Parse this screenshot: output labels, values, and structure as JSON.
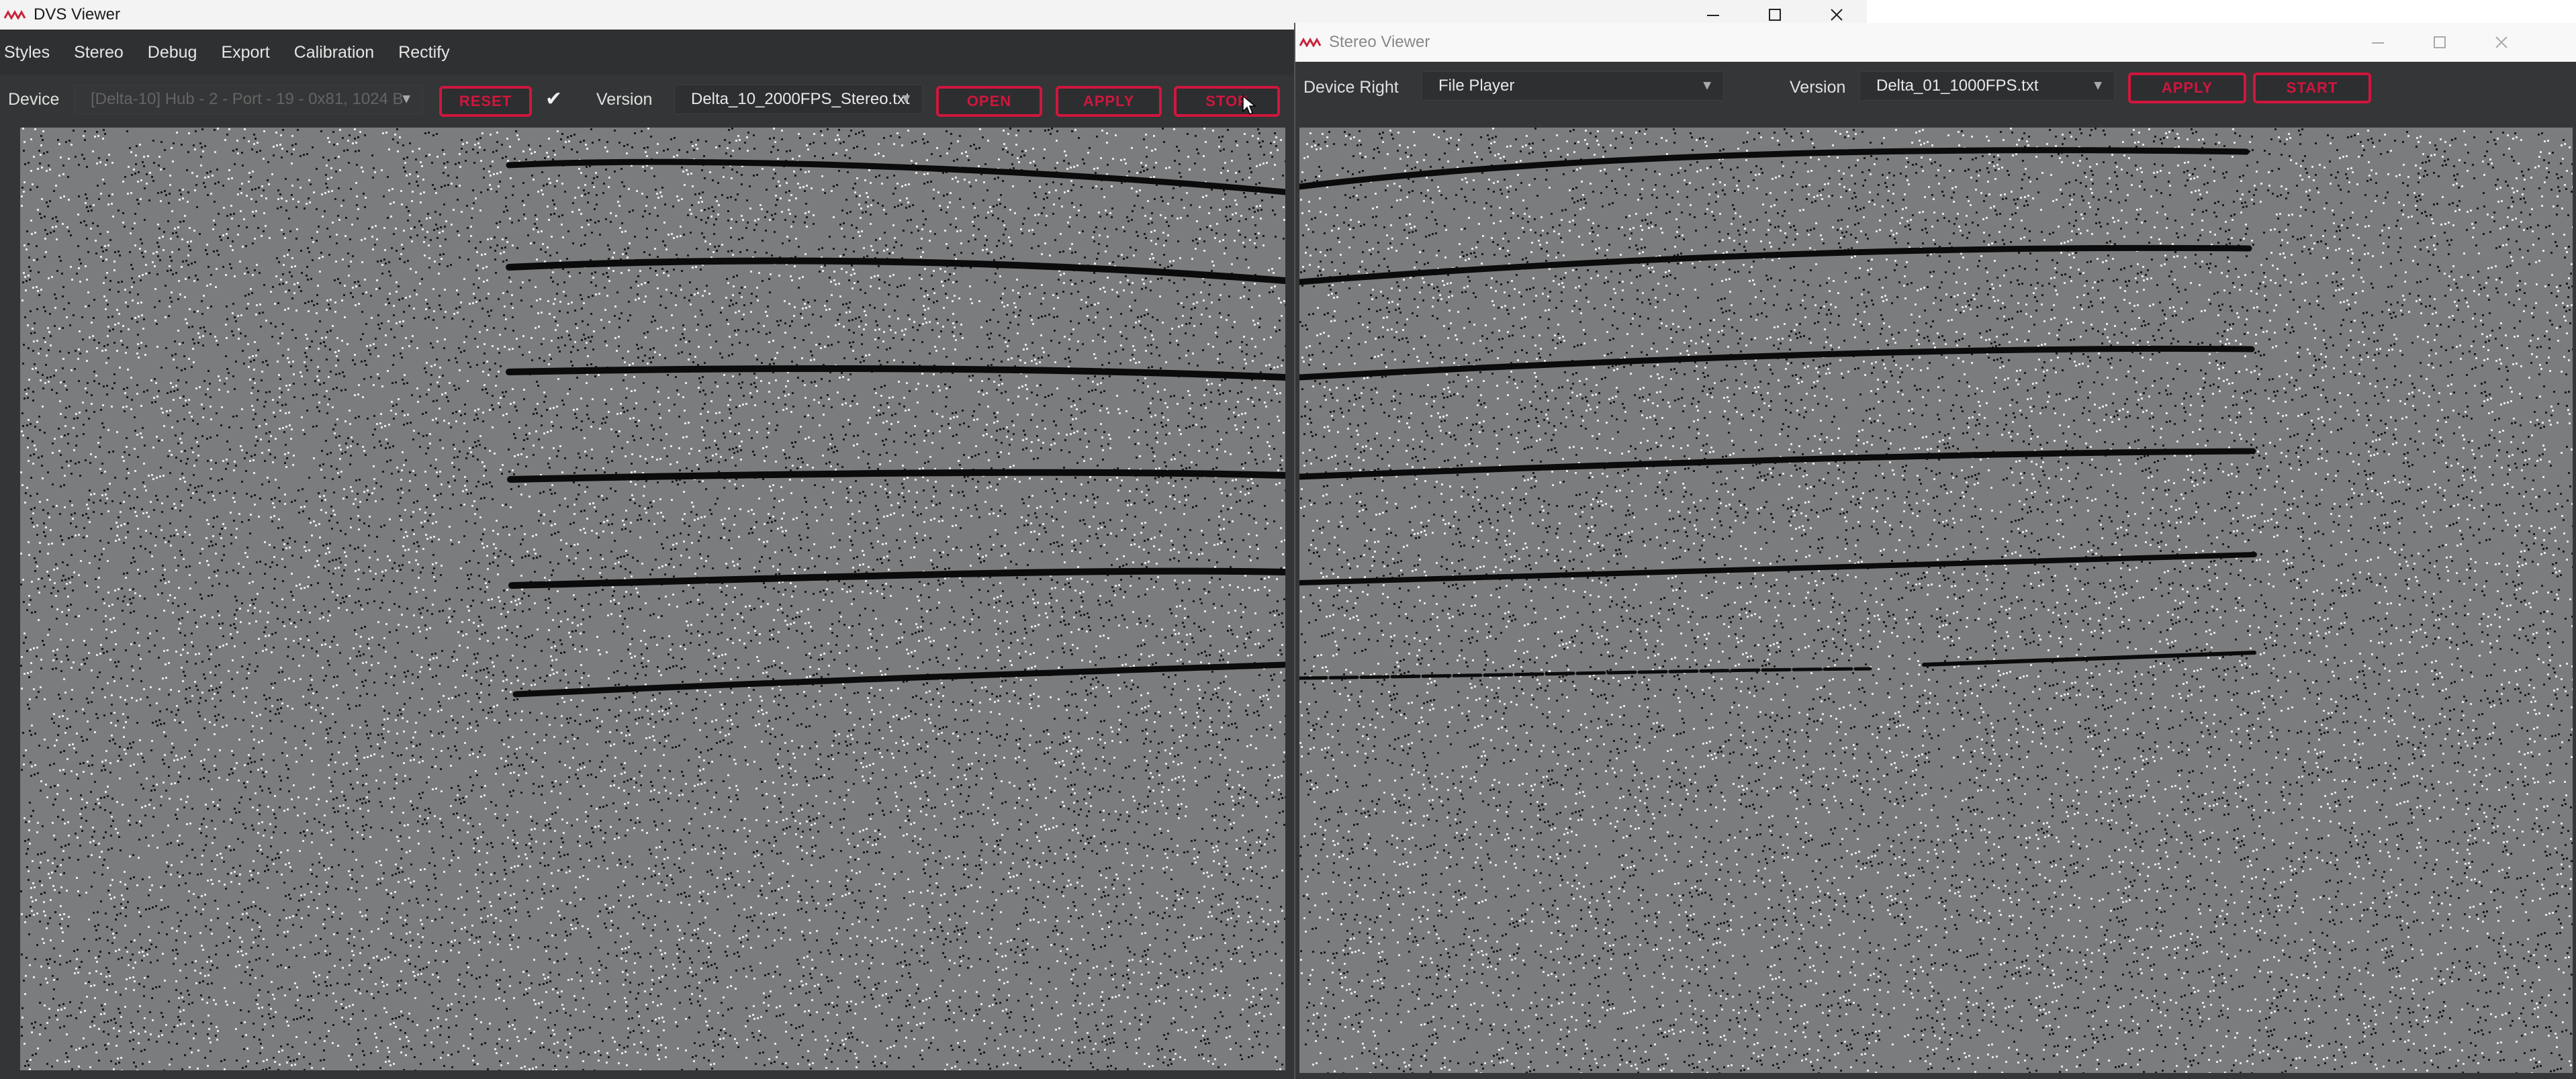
{
  "left_window": {
    "title": "DVS Viewer",
    "menu": [
      "Styles",
      "Stereo",
      "Debug",
      "Export",
      "Calibration",
      "Rectify"
    ],
    "toolbar": {
      "device_label": "Device",
      "device_value": "[Delta-10] Hub - 2 - Port - 19 - 0x81, 1024 B",
      "reset_label": "RESET",
      "check_glyph": "✔",
      "version_label": "Version",
      "version_value": "Delta_10_2000FPS_Stereo.txt",
      "open_label": "OPEN",
      "apply_label": "APPLY",
      "stop_label": "STOP"
    }
  },
  "right_window": {
    "title": "Stereo Viewer",
    "toolbar": {
      "device_label": "Device Right",
      "device_value": "File Player",
      "version_label": "Version",
      "version_value": "Delta_01_1000FPS.txt",
      "apply_label": "APPLY",
      "start_label": "START"
    }
  },
  "colors": {
    "accent": "#d0163d",
    "view_bg": "#7b7c7e",
    "window_bg": "#343536"
  },
  "icons": {
    "dropdown": "chevron-down-icon",
    "minimize": "minimize-icon",
    "maximize": "maximize-icon",
    "close": "close-icon",
    "logo": "app-logo-icon"
  }
}
